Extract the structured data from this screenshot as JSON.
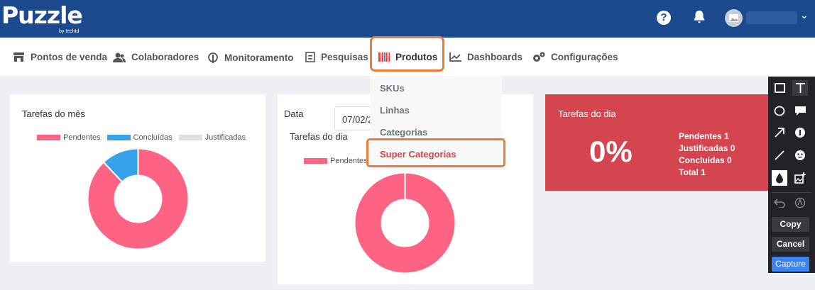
{
  "brand": {
    "name": "Puzzle",
    "sub": "by techtd"
  },
  "header": {
    "help_glyph": "?"
  },
  "nav": {
    "items": [
      {
        "label": "Pontos de venda",
        "icon": "store-icon"
      },
      {
        "label": "Colaboradores",
        "icon": "users-icon"
      },
      {
        "label": "Monitoramento",
        "icon": "broadcast-icon"
      },
      {
        "label": "Pesquisas",
        "icon": "survey-icon"
      },
      {
        "label": "Produtos",
        "icon": "barcode-icon"
      },
      {
        "label": "Dashboards",
        "icon": "line-chart-icon"
      },
      {
        "label": "Configurações",
        "icon": "cogs-icon"
      }
    ]
  },
  "dropdown": {
    "items": [
      "SKUs",
      "Linhas",
      "Categorias",
      "Super Categorias"
    ]
  },
  "card_month": {
    "title": "Tarefas do mês",
    "legend": [
      "Pendentes",
      "Concluídas",
      "Justificadas"
    ]
  },
  "card_day": {
    "date_label": "Data",
    "date_value": "07/02/2",
    "title": "Tarefas do dia",
    "legend": [
      "Pendentes"
    ]
  },
  "summary": {
    "title": "Tarefas do dia",
    "percent": "0%",
    "lines": [
      "Pendentes 1",
      "Justificadas 0",
      "Concluídas 0",
      "Total 1"
    ]
  },
  "capture_toolbar": {
    "copy": "Copy",
    "cancel": "Cancel",
    "capture": "Capture"
  },
  "colors": {
    "pendentes": "#fe6384",
    "concluidas": "#36a2eb",
    "justificadas": "#e0e0e0",
    "highlight": "#f07a3a"
  },
  "chart_data": [
    {
      "type": "pie",
      "title": "Tarefas do mês",
      "categories": [
        "Pendentes",
        "Concluídas",
        "Justificadas"
      ],
      "values": [
        88,
        12,
        0
      ]
    },
    {
      "type": "pie",
      "title": "Tarefas do dia",
      "categories": [
        "Pendentes"
      ],
      "values": [
        100
      ]
    }
  ]
}
